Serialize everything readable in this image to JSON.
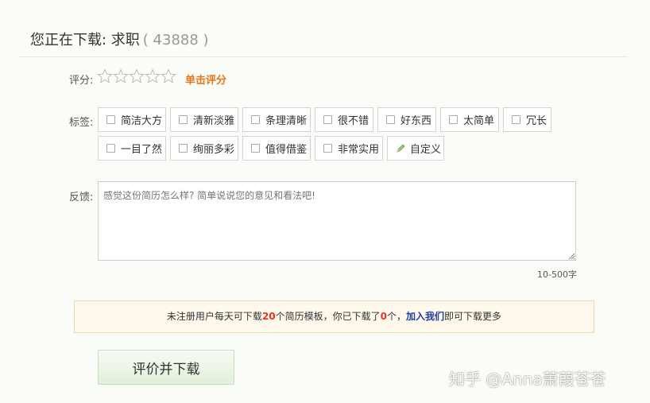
{
  "header": {
    "title_prefix": "您正在下载: 求职",
    "count": "( 43888 )"
  },
  "rating": {
    "label": "评分:",
    "star_count": 5,
    "hint": "单击评分"
  },
  "tags": {
    "label": "标签:",
    "row1": [
      "简洁大方",
      "清新淡雅",
      "条理清晰",
      "很不错",
      "好东西",
      "太简单",
      "冗长"
    ],
    "row2": [
      "一目了然",
      "绚丽多彩",
      "值得借鉴",
      "非常实用"
    ],
    "custom": "自定义"
  },
  "feedback": {
    "label": "反馈:",
    "placeholder": "感觉这份简历怎么样? 简单说说您的意见和看法吧!",
    "char_limit": "10-500字"
  },
  "notice": {
    "text_1": "未注册用户每天可下载",
    "daily_limit": "20",
    "text_2": "个简历模板，你已下载了",
    "downloaded": "0",
    "text_3": "个，",
    "join_link": "加入我们",
    "text_4": "即可下载更多"
  },
  "submit_label": "评价并下载",
  "watermark": "知乎 @Anna萧葭苍苍",
  "colors": {
    "accent_orange": "#e8751a",
    "highlight_red": "#e53322",
    "link_blue": "#1d3e9a"
  }
}
